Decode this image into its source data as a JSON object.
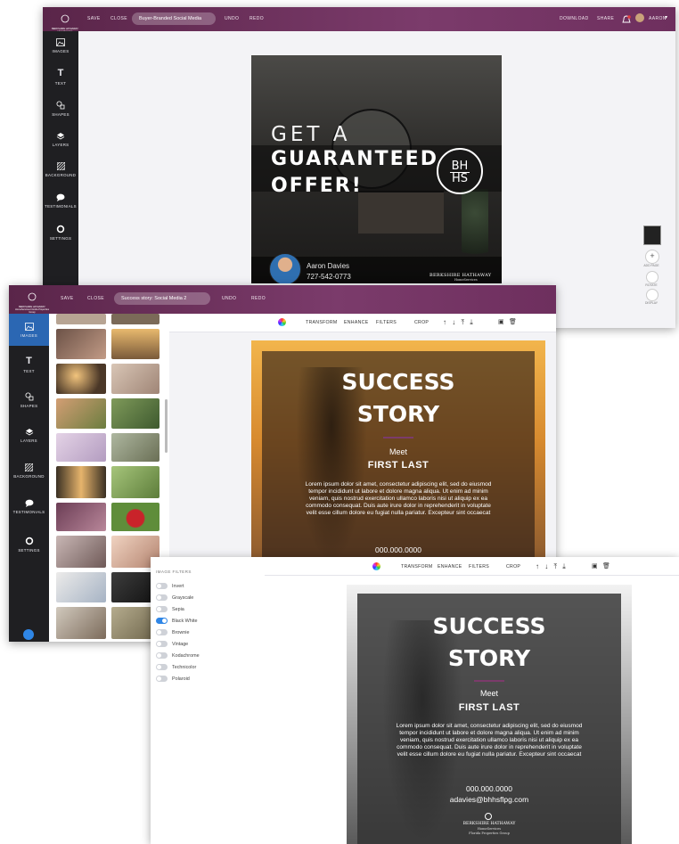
{
  "win1": {
    "brand": "BERKSHIRE HATHAWAY HomeServices",
    "save": "SAVE",
    "close": "CLOSE",
    "doc_title": "Buyer-Branded Social Media",
    "undo": "UNDO",
    "redo": "REDO",
    "download": "DOWNLOAD",
    "share": "SHARE",
    "user": "AARON",
    "sidebar": [
      "IMAGES",
      "TEXT",
      "SHAPES",
      "LAYERS",
      "BACKGROUND",
      "TESTIMONIALS",
      "SETTINGS"
    ],
    "poster": {
      "line1": "GET A",
      "line2": "GUARANTEED",
      "line3": "OFFER!",
      "logo_letters_top": "BH",
      "logo_letters_bottom": "HS",
      "agent_name": "Aaron Davies",
      "agent_phone": "727-542-0773",
      "footer_brand": "BERKSHIRE HATHAWAY",
      "footer_sub": "HomeServices"
    },
    "right_tools": [
      "ADD PAGE",
      "ROTATE",
      "DISPLAY"
    ]
  },
  "win2": {
    "brand": "BERKSHIRE HATHAWAY HomeServices Florida Properties Group",
    "save": "SAVE",
    "close": "CLOSE",
    "doc_title": "Success story: Social Media 2",
    "undo": "UNDO",
    "redo": "REDO",
    "sidebar": [
      "IMAGES",
      "TEXT",
      "SHAPES",
      "LAYERS",
      "BACKGROUND",
      "TESTIMONIALS",
      "SETTINGS"
    ],
    "toolbar": [
      "TRANSFORM",
      "ENHANCE",
      "FILTERS",
      "CROP"
    ],
    "poster": {
      "title1": "SUCCESS",
      "title2": "STORY",
      "meet": "Meet",
      "name": "FIRST LAST",
      "body": "Lorem ipsum dolor sit amet, consectetur adipiscing elit, sed do eiusmod tempor incididunt ut labore et dolore magna aliqua. Ut enim ad minim veniam, quis nostrud exercitation ullamco laboris nisi ut aliquip ex ea commodo consequat. Duis aute irure dolor in reprehenderit in voluptate velit esse cillum dolore eu fugiat nulla pariatur. Excepteur sint occaecat",
      "phone": "000.000.0000"
    }
  },
  "win3": {
    "toolbar": [
      "TRANSFORM",
      "ENHANCE",
      "FILTERS",
      "CROP"
    ],
    "filters_heading": "IMAGE FILTERS",
    "filters": [
      {
        "label": "Invert",
        "on": false
      },
      {
        "label": "Grayscale",
        "on": false
      },
      {
        "label": "Sepia",
        "on": false
      },
      {
        "label": "Black White",
        "on": true
      },
      {
        "label": "Brownie",
        "on": false
      },
      {
        "label": "Vintage",
        "on": false
      },
      {
        "label": "Kodachrome",
        "on": false
      },
      {
        "label": "Technicolor",
        "on": false
      },
      {
        "label": "Polaroid",
        "on": false
      }
    ],
    "poster": {
      "title1": "SUCCESS",
      "title2": "STORY",
      "meet": "Meet",
      "name": "FIRST LAST",
      "body": "Lorem ipsum dolor sit amet, consectetur adipiscing elit, sed do eiusmod tempor incididunt ut labore et dolore magna aliqua. Ut enim ad minim veniam, quis nostrud exercitation ullamco laboris nisi ut aliquip ex ea commodo consequat. Duis aute irure dolor in reprehenderit in voluptate velit esse cillum dolore eu fugiat nulla pariatur. Excepteur sint occaecat",
      "phone": "000.000.0000",
      "email": "adavies@bhhsflpg.com",
      "footer_brand": "BERKSHIRE HATHAWAY",
      "footer_sub": "HomeServices",
      "footer_sub2": "Florida Properties Group"
    }
  },
  "colors": {
    "topbar": "#6e2f5e",
    "accent": "#2f86e6",
    "sidebar": "#1f1f22",
    "divider": "#7b3b6b"
  }
}
